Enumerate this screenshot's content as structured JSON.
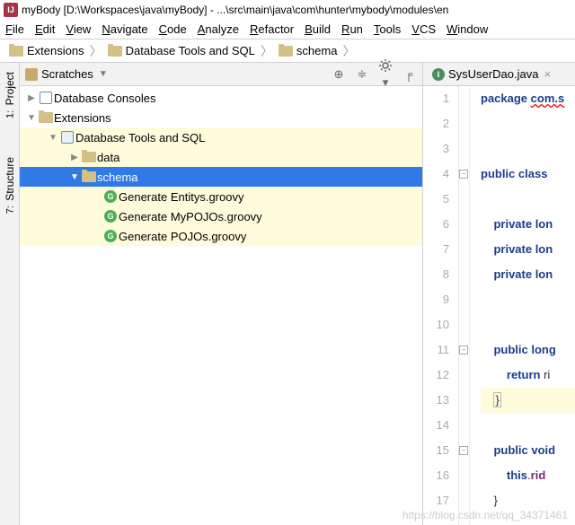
{
  "title": "myBody [D:\\Workspaces\\java\\myBody] - ...\\src\\main\\java\\com\\hunter\\mybody\\modules\\en",
  "menu": [
    "File",
    "Edit",
    "View",
    "Navigate",
    "Code",
    "Analyze",
    "Refactor",
    "Build",
    "Run",
    "Tools",
    "VCS",
    "Window"
  ],
  "breadcrumb": [
    "Extensions",
    "Database Tools and SQL",
    "schema"
  ],
  "sideTabs": [
    {
      "num": "1:",
      "label": "Project"
    },
    {
      "num": "7:",
      "label": "Structure"
    }
  ],
  "panel": {
    "title": "Scratches"
  },
  "tree": [
    {
      "indent": 0,
      "arrow": "▶",
      "icon": "db",
      "label": "Database Consoles",
      "hl": false,
      "sel": false
    },
    {
      "indent": 0,
      "arrow": "▼",
      "icon": "folder",
      "label": "Extensions",
      "hl": false,
      "sel": false
    },
    {
      "indent": 1,
      "arrow": "▼",
      "icon": "db2",
      "label": "Database Tools and SQL",
      "hl": true,
      "sel": false
    },
    {
      "indent": 2,
      "arrow": "▶",
      "icon": "folder",
      "label": "data",
      "hl": true,
      "sel": false
    },
    {
      "indent": 2,
      "arrow": "▼",
      "icon": "folder",
      "label": "schema",
      "hl": false,
      "sel": true
    },
    {
      "indent": 3,
      "arrow": "",
      "icon": "g",
      "label": "Generate Entitys.groovy",
      "hl": true,
      "sel": false
    },
    {
      "indent": 3,
      "arrow": "",
      "icon": "g",
      "label": "Generate MyPOJOs.groovy",
      "hl": true,
      "sel": false
    },
    {
      "indent": 3,
      "arrow": "",
      "icon": "g",
      "label": "Generate POJOs.groovy",
      "hl": true,
      "sel": false
    }
  ],
  "editorTab": {
    "name": "SysUserDao.java"
  },
  "code": {
    "lines": [
      {
        "n": 1,
        "t": "package",
        "html": "<span class='kw'>package</span> <span class='err'>com.s</span>"
      },
      {
        "n": 2,
        "t": "",
        "html": ""
      },
      {
        "n": 3,
        "t": "",
        "html": ""
      },
      {
        "n": 4,
        "t": "class",
        "html": "<span class='kw'>public class</span> "
      },
      {
        "n": 5,
        "t": "",
        "html": ""
      },
      {
        "n": 6,
        "t": "priv",
        "html": "    <span class='kw'>private lon</span>"
      },
      {
        "n": 7,
        "t": "priv",
        "html": "    <span class='kw'>private lon</span>"
      },
      {
        "n": 8,
        "t": "priv",
        "html": "    <span class='kw'>private lon</span>"
      },
      {
        "n": 9,
        "t": "",
        "html": ""
      },
      {
        "n": 10,
        "t": "",
        "html": ""
      },
      {
        "n": 11,
        "t": "pub",
        "html": "    <span class='kw'>public long</span>"
      },
      {
        "n": 12,
        "t": "ret",
        "html": "        <span class='kw'>return</span> ri"
      },
      {
        "n": 13,
        "t": "brace",
        "html": "<span class='hl-line'>    <span class='brace-hl'>}</span></span>"
      },
      {
        "n": 14,
        "t": "",
        "html": ""
      },
      {
        "n": 15,
        "t": "void",
        "html": "    <span class='kw'>public void</span>"
      },
      {
        "n": 16,
        "t": "this",
        "html": "        <span class='kw'>this</span>.<span class='fld'>rid</span>"
      },
      {
        "n": 17,
        "t": "end",
        "html": "    }"
      }
    ]
  },
  "watermark": "https://blog.csdn.net/qq_34371461"
}
